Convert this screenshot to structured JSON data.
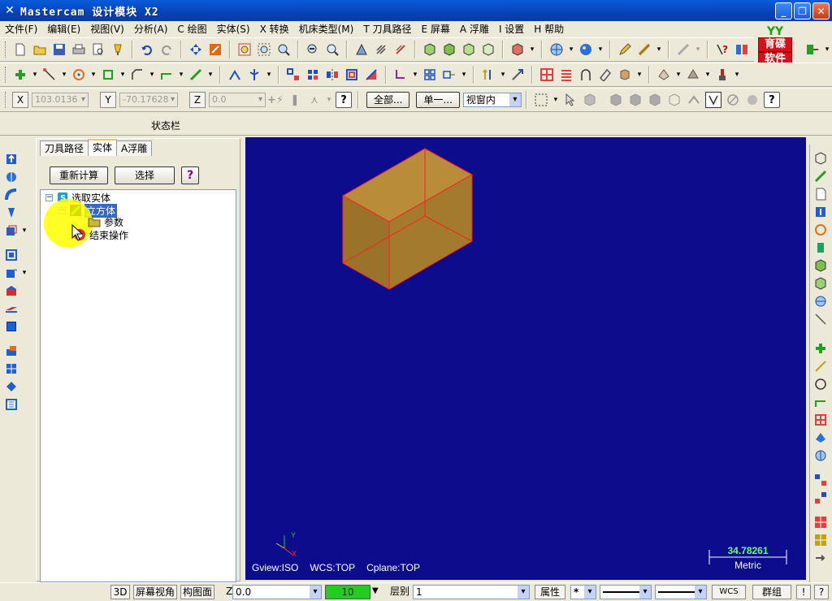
{
  "window": {
    "title": "Mastercam 设计模块  X2",
    "min_label": "_",
    "max_label": "❐",
    "close_label": "✕"
  },
  "menu": [
    "文件(F)",
    "编辑(E)",
    "视图(V)",
    "分析(A)",
    "C 绘图",
    "实体(S)",
    "X 转换",
    "机床类型(M)",
    "T 刀具路径",
    "E 屏幕",
    "A 浮雕",
    "I 设置",
    "H 帮助"
  ],
  "brand": {
    "top": "YY",
    "line1": "育碟",
    "line2": "软件"
  },
  "coords": {
    "x_label": "X",
    "x_value": "103.0136",
    "y_label": "Y",
    "y_value": "-70.17628",
    "z_label": "Z",
    "z_value": "0.0"
  },
  "selection": {
    "all_button": "全部...",
    "single_button": "单一...",
    "mode_value": "视窗内"
  },
  "status_label": "状态栏",
  "panel": {
    "tabs": [
      "刀具路径",
      "实体",
      "A浮雕"
    ],
    "active_tab": 1,
    "recalc_button": "重新计算",
    "select_button": "选择",
    "help_label": "?",
    "tree": {
      "root_label": "选取实体",
      "solid_label": "立方体",
      "params_label": "参数",
      "end_label": "结束操作"
    }
  },
  "viewport": {
    "background": "#0c0c8c",
    "gview": "Gview:ISO",
    "wcs": "WCS:TOP",
    "cplane": "Cplane:TOP",
    "scale_value": "34.78261",
    "scale_unit": "Metric",
    "axis_x": "X",
    "axis_y": "Y"
  },
  "bottom": {
    "btn_3d": "3D",
    "screen_view": "屏幕视角",
    "cplane": "构图面",
    "z_label": "Z",
    "z_value": "0.0",
    "color_value": "10",
    "level_label": "层别",
    "level_value": "1",
    "attributes": "属性",
    "point_style": "*",
    "wcs": "WCS",
    "group": "群组",
    "help": "!",
    "question": "?"
  },
  "colors": {
    "solid_face": "#a07828",
    "solid_edge": "#ff2020",
    "color_indicator": "#22cc22"
  }
}
